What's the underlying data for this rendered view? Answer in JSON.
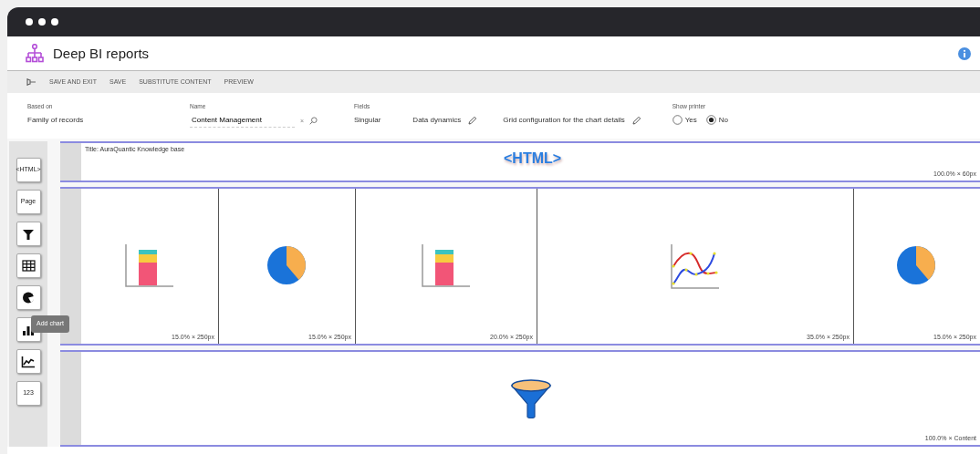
{
  "app": {
    "title": "Deep BI reports"
  },
  "toolbar": [
    {
      "label": "SAVE AND EXIT"
    },
    {
      "label": "SAVE"
    },
    {
      "label": "SUBSTITUTE CONTENT"
    },
    {
      "label": "PREVIEW"
    }
  ],
  "fields": {
    "based_on": {
      "label": "Based on",
      "value": "Family of records"
    },
    "name": {
      "label": "Name",
      "value": "Content Management",
      "clear": "×"
    },
    "fields": {
      "label": "Fields",
      "values": [
        "Singular",
        "Data dynamics",
        "Grid configuration for the chart details"
      ]
    },
    "show_printer": {
      "label": "Show printer",
      "options": [
        {
          "label": "Yes",
          "selected": false
        },
        {
          "label": "No",
          "selected": true
        }
      ]
    }
  },
  "tools": [
    {
      "kind": "text",
      "label": "<HTML>"
    },
    {
      "kind": "text",
      "label": "Page"
    },
    {
      "kind": "funnel"
    },
    {
      "kind": "grid"
    },
    {
      "kind": "pie"
    },
    {
      "kind": "bar"
    },
    {
      "kind": "line"
    },
    {
      "kind": "text",
      "label": "123"
    }
  ],
  "tooltip": "Add chart",
  "sections": [
    {
      "kind": "html",
      "title": "Title: AuraQuantic Knowledge base",
      "content": "<HTML>",
      "size": "100.0% × 60px"
    },
    {
      "kind": "charts",
      "cells": [
        {
          "kind": "bar",
          "size": "15.0% × 250px"
        },
        {
          "kind": "pie",
          "size": "15.0% × 250px"
        },
        {
          "kind": "bar",
          "size": "20.0% × 250px"
        },
        {
          "kind": "line",
          "size": "35.0% × 250px"
        },
        {
          "kind": "pie",
          "size": "15.0% × 250px"
        }
      ]
    },
    {
      "kind": "filter",
      "size": "100.0% × Content"
    }
  ]
}
